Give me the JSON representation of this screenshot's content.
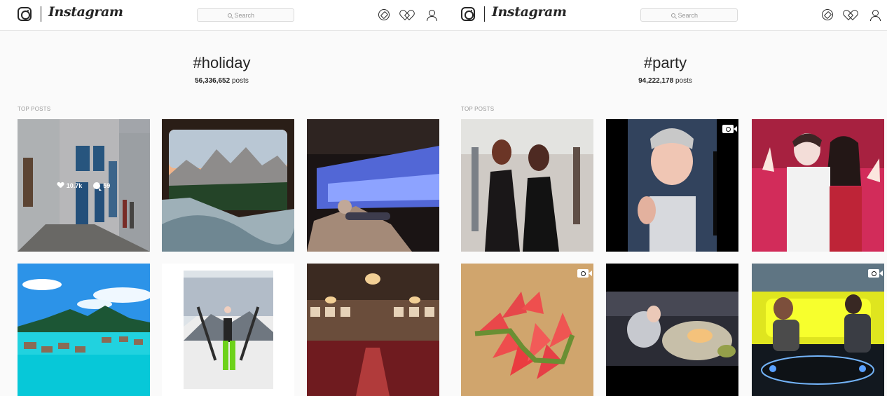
{
  "window": {
    "left": {
      "brand": "Instagram",
      "search_placeholder": "Search",
      "tag": "#holiday",
      "post_count_value": "56,336,652",
      "post_count_suffix": " posts",
      "section_label": "TOP POSTS",
      "featured_likes": "10.7k",
      "featured_comments": "59"
    },
    "right": {
      "brand": "Instagram",
      "search_placeholder": "Search",
      "tag": "#party",
      "post_count_value": "94,222,178",
      "post_count_suffix": " posts",
      "section_label": "TOP POSTS"
    }
  },
  "icons": {
    "logo": "instagram-camera-icon",
    "search": "search-icon",
    "explore": "compass-icon",
    "activity": "heart-icon",
    "profile": "user-icon",
    "video": "video-camera-icon",
    "likes": "heart-icon",
    "comments": "comment-icon"
  },
  "colors": {
    "text_primary": "#262626",
    "text_secondary": "#999999",
    "background": "#fafafa",
    "header": "#ffffff"
  }
}
